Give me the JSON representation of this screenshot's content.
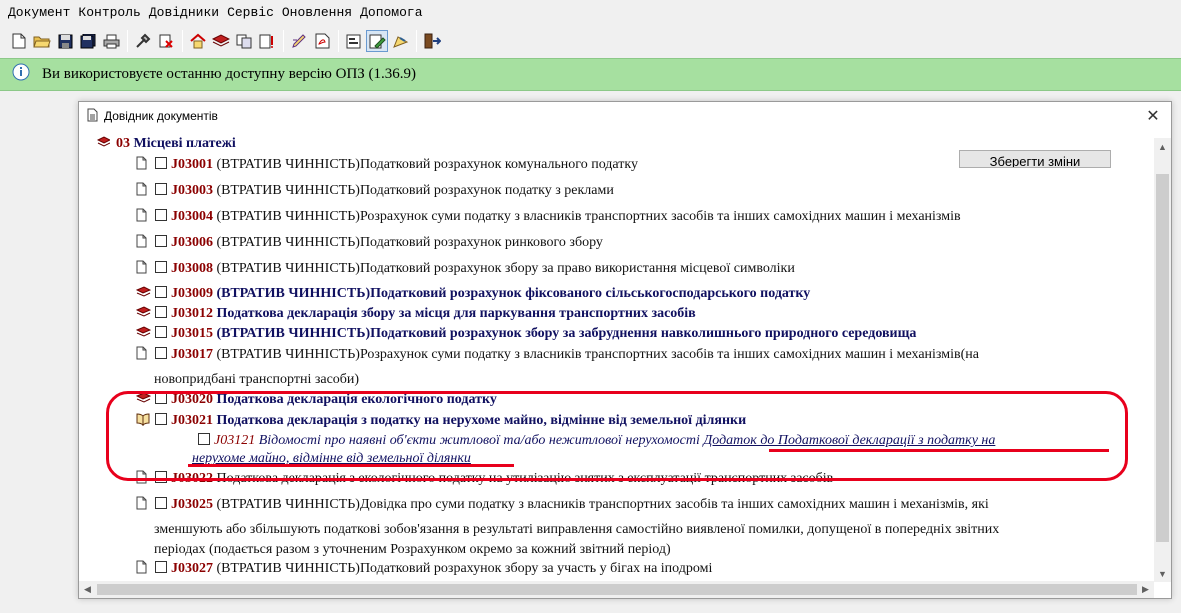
{
  "menu": [
    "Документ",
    "Контроль",
    "Довідники",
    "Сервіс",
    "Оновлення",
    "Допомога"
  ],
  "toolbar_icons": [
    "new-doc-icon",
    "open-folder-icon",
    "save-icon",
    "save-all-icon",
    "print-icon",
    "tools-icon",
    "delete-icon",
    "home-icon",
    "books-icon",
    "copy-icon",
    "sign-icon",
    "edit-icon",
    "pdf-icon",
    "settings-icon",
    "doc-edit-icon",
    "highlight-icon",
    "exit-icon"
  ],
  "banner": {
    "text": "Ви використовуєте останню доступну версію ОПЗ (1.36.9)",
    "color": "#a6e0a0"
  },
  "dialog": {
    "title": "Довідник документів",
    "save_label": "Зберегти зміни",
    "group": {
      "code": "03",
      "name": "Місцеві платежі"
    },
    "items": [
      {
        "code": "J03001",
        "status": "(ВТРАТИВ ЧИННІСТЬ)",
        "name": "Податковий розрахунок комунального податку",
        "icon": "doc-icon",
        "bold": false
      },
      {
        "code": "J03003",
        "status": "(ВТРАТИВ ЧИННІСТЬ)",
        "name": "Податковий розрахунок податку з реклами",
        "icon": "doc-icon",
        "bold": false
      },
      {
        "code": "J03004",
        "status": "(ВТРАТИВ ЧИННІСТЬ)",
        "name": "Розрахунок суми податку з власників транспортних засобів та інших самохідних машин і механізмів",
        "icon": "doc-icon",
        "bold": false
      },
      {
        "code": "J03006",
        "status": "(ВТРАТИВ ЧИННІСТЬ)",
        "name": "Податковий розрахунок ринкового збору",
        "icon": "doc-icon",
        "bold": false
      },
      {
        "code": "J03008",
        "status": "(ВТРАТИВ ЧИННІСТЬ)",
        "name": "Податковий розрахунок збору за право використання місцевої символіки",
        "icon": "doc-icon",
        "bold": false
      },
      {
        "code": "J03009",
        "status": "(ВТРАТИВ ЧИННІСТЬ)",
        "name": "Податковий розрахунок фіксованого сільськогосподарського податку",
        "icon": "book-icon",
        "bold": true
      },
      {
        "code": "J03012",
        "status": "",
        "name": "Податкова декларація збору за місця для паркування транспортних засобів",
        "icon": "book-icon",
        "bold": true
      },
      {
        "code": "J03015",
        "status": "(ВТРАТИВ ЧИННІСТЬ)",
        "name": "Податковий розрахунок збору за забруднення навколишнього природного середовища",
        "icon": "book-icon",
        "bold": true
      },
      {
        "code": "J03017",
        "status": "(ВТРАТИВ ЧИННІСТЬ)",
        "name": "Розрахунок суми податку з власників транспортних засобів та інших самохідних машин і механізмів(на",
        "cont": "новопридбані транспортні засоби)",
        "icon": "doc-icon",
        "bold": false
      },
      {
        "code": "J03020",
        "status": "",
        "name": "Податкова декларація екологічного податку",
        "icon": "book-icon",
        "bold": true
      },
      {
        "code": "J03021",
        "status": "",
        "name": "Податкова декларація з податку на нерухоме майно, відмінне від земельної ділянки",
        "icon": "open-book-icon",
        "bold": true
      },
      {
        "code": "J03022",
        "status": "",
        "name": "Податкова декларація з екологічного податку на утилізацію знятих з експлуатації транспортних засобів",
        "icon": "doc-icon",
        "bold": false
      },
      {
        "code": "J03025",
        "status": "(ВТРАТИВ ЧИННІСТЬ)",
        "name": "Довідка про суми податку з власників транспортних засобів та інших самохідних машин і механізмів, які",
        "cont": "зменшують або збільшують податкові зобов'язання в результаті виправлення самостійно виявленої помилки, допущеної в попередніх звітних",
        "cont2": "періодах (подається разом з уточненим Розрахунком окремо за кожний звітний період)",
        "icon": "doc-icon",
        "bold": false
      },
      {
        "code": "J03027",
        "status": "(ВТРАТИВ ЧИННІСТЬ)",
        "name": "Податковий розрахунок збору за участь у бігах на іподромі",
        "icon": "doc-icon",
        "bold": false
      }
    ],
    "subitem": {
      "code": "J03121",
      "name": "Відомості про наявні об'єкти житлової та/або нежитлової нерухомості",
      "link1": "Додаток до Податкової декларації з податку на",
      "link2": "нерухоме майно, відмінне від земельної ділянки"
    }
  },
  "highlight_color": "#e8001c"
}
